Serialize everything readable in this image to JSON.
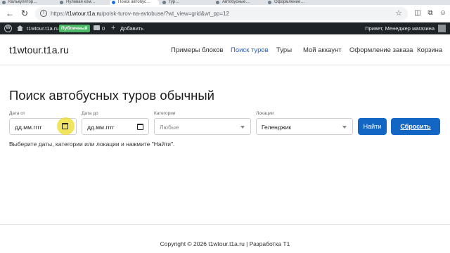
{
  "browser": {
    "tabs": [
      "Калькулятор…",
      "Нулевая ком…",
      "Поиск автобус…",
      "тур…",
      "Автобусные…",
      "Оформление…"
    ],
    "url_prefix": "https://",
    "url_domain": "t1wtour.t1a.ru",
    "url_path": "/polsk-turov-na-avtobuse/?wt_view=grid&wt_pp=12"
  },
  "adminbar": {
    "site_name": "t1wtour.t1a.ru",
    "badge": "Публичный",
    "comments_count": "0",
    "new_label": "Добавить",
    "greeting": "Привет, Менеджер магазина"
  },
  "header": {
    "logo": "t1wtour.t1a.ru",
    "nav": [
      "Примеры блоков",
      "Поиск туров",
      "Туры",
      "Мой аккаунт",
      "Оформление заказа",
      "Корзина"
    ]
  },
  "main": {
    "title": "Поиск автобусных туров обычный",
    "date_from": {
      "label": "Дата от",
      "value": "дд.мм.гггг"
    },
    "date_to": {
      "label": "Дата до",
      "value": "дд.мм.гггг"
    },
    "categories": {
      "label": "Категории",
      "value": "Любые"
    },
    "locations": {
      "label": "Локации",
      "value": "Геленджик"
    },
    "find_button": "Найти",
    "reset_button": "Сбросить",
    "hint": "Выберите даты, категории или локации и нажмите \"Найти\"."
  },
  "footer": {
    "copyright": "Copyright © 2026 t1wtour.t1a.ru | Разработка T1"
  },
  "colors": {
    "accent": "#1466c4",
    "adminbar": "#1d2327",
    "badge": "#4ab866",
    "highlight": "#eedc28"
  }
}
